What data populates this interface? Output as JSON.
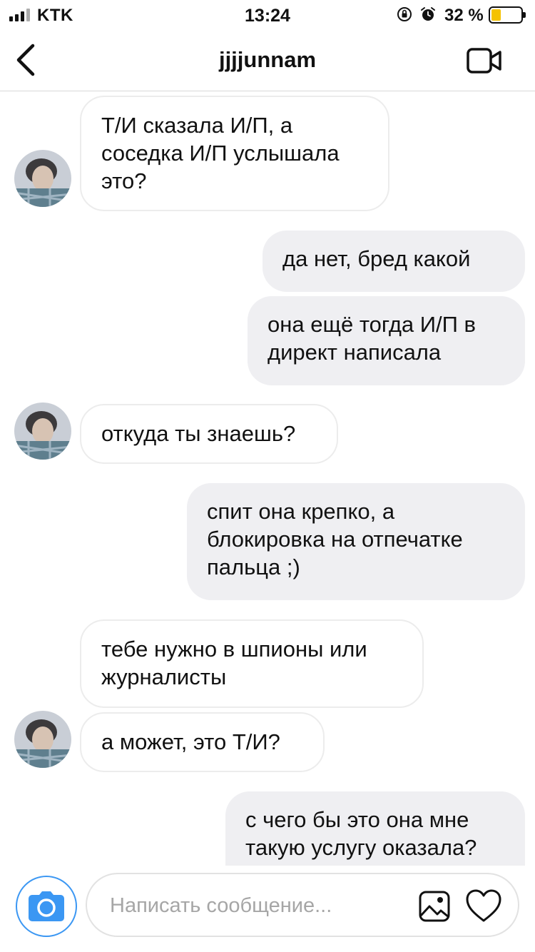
{
  "status_bar": {
    "carrier": "KTK",
    "time": "13:24",
    "battery_percent": "32 %",
    "battery_level": 0.32,
    "icons": [
      "signal-icon",
      "rotation-lock-icon",
      "alarm-icon",
      "battery-icon"
    ]
  },
  "header": {
    "username": "jjjjunnam",
    "icons": [
      "back-chevron-icon",
      "video-call-icon"
    ]
  },
  "messages": [
    {
      "from": "them",
      "text": "Т/И сказала И/П, а соседка И/П услышала это?"
    },
    {
      "from": "me",
      "text": "да нет, бред какой"
    },
    {
      "from": "me",
      "text": "она ещё тогда И/П в директ написала"
    },
    {
      "from": "them",
      "text": "откуда ты знаешь?"
    },
    {
      "from": "me",
      "text": "спит она крепко, а блокировка на отпечатке пальца ;)"
    },
    {
      "from": "them",
      "text": "тебе нужно в шпионы или журналисты"
    },
    {
      "from": "them",
      "text": "а может, это Т/И?"
    },
    {
      "from": "me",
      "text": "с чего бы это она мне такую услугу оказала?"
    }
  ],
  "composer": {
    "placeholder": "Написать сообщение...",
    "value": "",
    "icons": [
      "camera-icon",
      "gallery-icon",
      "heart-icon"
    ]
  },
  "colors": {
    "accent_blue": "#3b97f3",
    "outgoing_bubble": "#efeff2",
    "incoming_border": "#ececec",
    "battery_fill": "#f5c200"
  }
}
